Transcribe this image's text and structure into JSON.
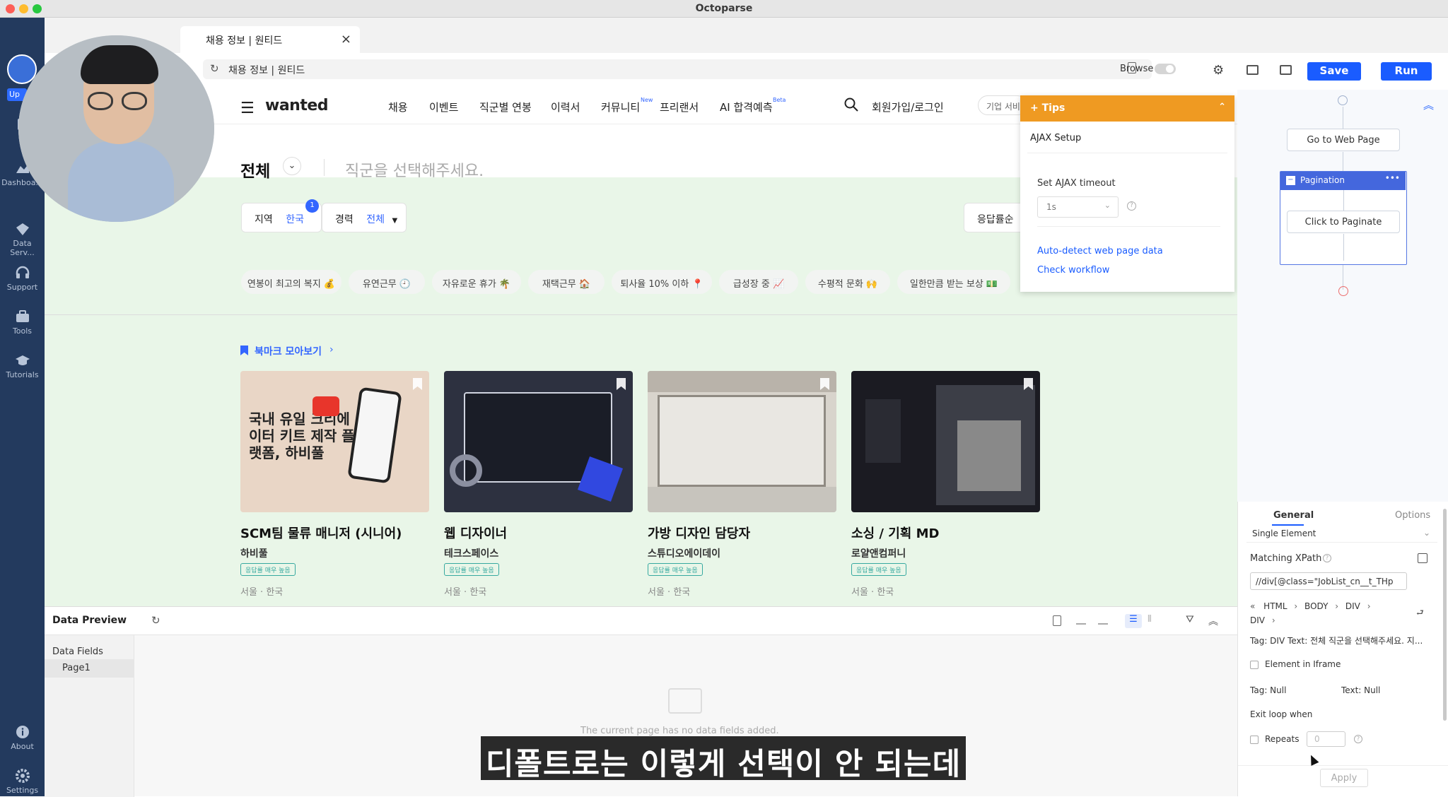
{
  "app": {
    "title": "Octoparse"
  },
  "sidebar": {
    "top_badge": "Up",
    "items": [
      {
        "label": "N",
        "icon": "new-icon"
      },
      {
        "label": "Dashboa...",
        "icon": "dashboard-icon"
      },
      {
        "label": "Data Serv...",
        "icon": "data-service-icon"
      },
      {
        "label": "Support",
        "icon": "headset-icon"
      },
      {
        "label": "Tools",
        "icon": "toolbox-icon"
      },
      {
        "label": "Tutorials",
        "icon": "graduation-cap-icon"
      },
      {
        "label": "About",
        "icon": "info-icon"
      },
      {
        "label": "Settings",
        "icon": "gear-icon"
      }
    ]
  },
  "tabbar": {
    "tab_label": "채용 정보 | 원티드",
    "close": "×"
  },
  "urlbar": {
    "url": "채용 정보 | 원티드",
    "browse_label": "Browse"
  },
  "toolbar": {
    "save_label": "Save",
    "run_label": "Run"
  },
  "site": {
    "logo": "wanted",
    "nav": [
      "채용",
      "이벤트",
      "직군별 연봉",
      "이력서",
      "커뮤니티",
      "프리랜서",
      "AI 합격예측"
    ],
    "nav_new": "New",
    "nav_beta": "Beta",
    "login": "회원가입/로그인",
    "corp_service": "기업 서비",
    "category": "전체",
    "job_placeholder": "직군을 선택해주세요.",
    "filters": {
      "region_label": "지역",
      "region_value": "한국",
      "region_count": "1",
      "career_label": "경력",
      "career_value": "전체",
      "sort_label": "응답률순"
    },
    "chips": [
      "연봉이 최고의 복지 💰",
      "유연근무 🕘",
      "자유로운 휴가 🌴",
      "재택근무 🏠",
      "퇴사율 10% 이하 📍",
      "급성장 중 📈",
      "수평적 문화 🙌",
      "일한만큼 받는 보상 💵"
    ],
    "bookmark_link": "북마크 모아보기",
    "cards": [
      {
        "title": "SCM팀 물류 매니저 (시니어)",
        "company": "하비풀",
        "badge": "응답률 매우 높음",
        "location": "서울 · 한국",
        "img_text": "국내 유일 크리에이터 키트 제작 플랫폼, 하비풀"
      },
      {
        "title": "웹 디자이너",
        "company": "테크스페이스",
        "badge": "응답률 매우 높음",
        "location": "서울 · 한국"
      },
      {
        "title": "가방 디자인 담당자",
        "company": "스튜디오에이데이",
        "badge": "응답률 매우 높음",
        "location": "서울 · 한국"
      },
      {
        "title": "소싱 / 기획 MD",
        "company": "로얄앤컴퍼니",
        "badge": "응답률 매우 높음",
        "location": "서울 · 한국"
      }
    ]
  },
  "tips": {
    "header": "+ Tips",
    "section": "AJAX Setup",
    "timeout_label": "Set AJAX timeout",
    "timeout_value": "1s",
    "links": [
      "Auto-detect web page data",
      "Check workflow"
    ]
  },
  "workflow": {
    "go_to": "Go to Web Page",
    "loop": "Pagination",
    "click": "Click to Paginate"
  },
  "settings": {
    "tabs": [
      "General",
      "Options"
    ],
    "mode": "Single Element",
    "xpath_label": "Matching XPath",
    "xpath_value": "//div[@class=\"JobList_cn__t_THp",
    "breadcrumb": [
      "HTML",
      "BODY",
      "DIV",
      "DIV"
    ],
    "tag_text": "Tag: DIV Text: 전체 직군을 선택해주세요. 지...",
    "iframe_label": "Element in Iframe",
    "tag_null": "Tag: Null",
    "text_null": "Text: Null",
    "exit_label": "Exit loop when",
    "repeats_label": "Repeats",
    "repeats_value": "0",
    "apply": "Apply"
  },
  "preview": {
    "title": "Data Preview",
    "fields_label": "Data Fields",
    "page_label": "Page1",
    "empty_msg": "The current page has no data fields added."
  },
  "subtitle": "디폴트로는 이렇게 선택이 안 되는데",
  "colors": {
    "accent": "#1a5cff",
    "sidebar": "#233a5e",
    "tips": "#ef9a22",
    "site_blue": "#3366ff"
  }
}
